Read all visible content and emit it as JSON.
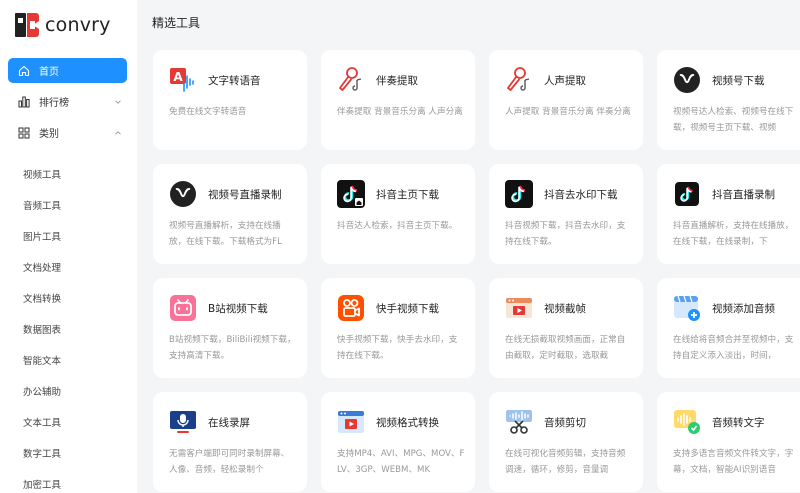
{
  "brand": {
    "name": "convry"
  },
  "nav": {
    "home": "首页",
    "ranking": "排行榜",
    "category": "类别"
  },
  "categories": [
    "视频工具",
    "音频工具",
    "图片工具",
    "文档处理",
    "文档转换",
    "数据图表",
    "智能文本",
    "办公辅助",
    "文本工具",
    "数字工具",
    "加密工具"
  ],
  "main": {
    "section_title": "精选工具",
    "cards": [
      {
        "title": "文字转语音",
        "desc": "免费在线文字转语音",
        "icon": "text-to-speech-icon"
      },
      {
        "title": "伴奏提取",
        "desc": "伴奏提取 背景音乐分离 人声分离",
        "icon": "microphone-icon"
      },
      {
        "title": "人声提取",
        "desc": "人声提取 背景音乐分离 伴奏分离",
        "icon": "microphone-icon"
      },
      {
        "title": "视频号下载",
        "desc": "视频号达人检索、视频号在线下载，视频号主页下载、视频",
        "icon": "channels-icon"
      },
      {
        "title": "视频号直播录制",
        "desc": "视频号直播解析，支持在线播放，在线下载。下载格式为FL",
        "icon": "channels-icon"
      },
      {
        "title": "抖音主页下载",
        "desc": "抖音达人检索，抖音主页下载。",
        "icon": "tiktok-icon"
      },
      {
        "title": "抖音去水印下载",
        "desc": "抖音视频下载，抖音去水印，支持在线下载。",
        "icon": "tiktok-icon"
      },
      {
        "title": "抖音直播录制",
        "desc": "抖音直播解析，支持在线播放，在线下载，在线录制，下",
        "icon": "tiktok-icon"
      },
      {
        "title": "B站视频下载",
        "desc": "B站视频下载，BiliBili视频下载，支持高清下载。",
        "icon": "bilibili-icon"
      },
      {
        "title": "快手视频下载",
        "desc": "快手视频下载，快手去水印，支持在线下载。",
        "icon": "kuaishou-icon"
      },
      {
        "title": "视频截帧",
        "desc": "在线无损截取视频画面，正常自由截取，定时截取，选取截",
        "icon": "video-frame-icon"
      },
      {
        "title": "视频添加音频",
        "desc": "在线给将音频合并至视频中，支持自定义添入淡出，时间，",
        "icon": "video-add-audio-icon"
      },
      {
        "title": "在线录屏",
        "desc": "无需客户端即可同时录制屏幕、人像、音频，轻松录制个",
        "icon": "screen-record-icon"
      },
      {
        "title": "视频格式转换",
        "desc": "支持MP4、AVI、MPG、MOV、FLV、3GP、WEBM、MK",
        "icon": "video-convert-icon"
      },
      {
        "title": "音频剪切",
        "desc": "在线可视化音频剪辑，支持音频调速，循环，修剪，音量调",
        "icon": "audio-cut-icon"
      },
      {
        "title": "音频转文字",
        "desc": "支持多语言音频文件转文字，字幕，文档，智能AI识别语音",
        "icon": "audio-to-text-icon"
      }
    ]
  }
}
